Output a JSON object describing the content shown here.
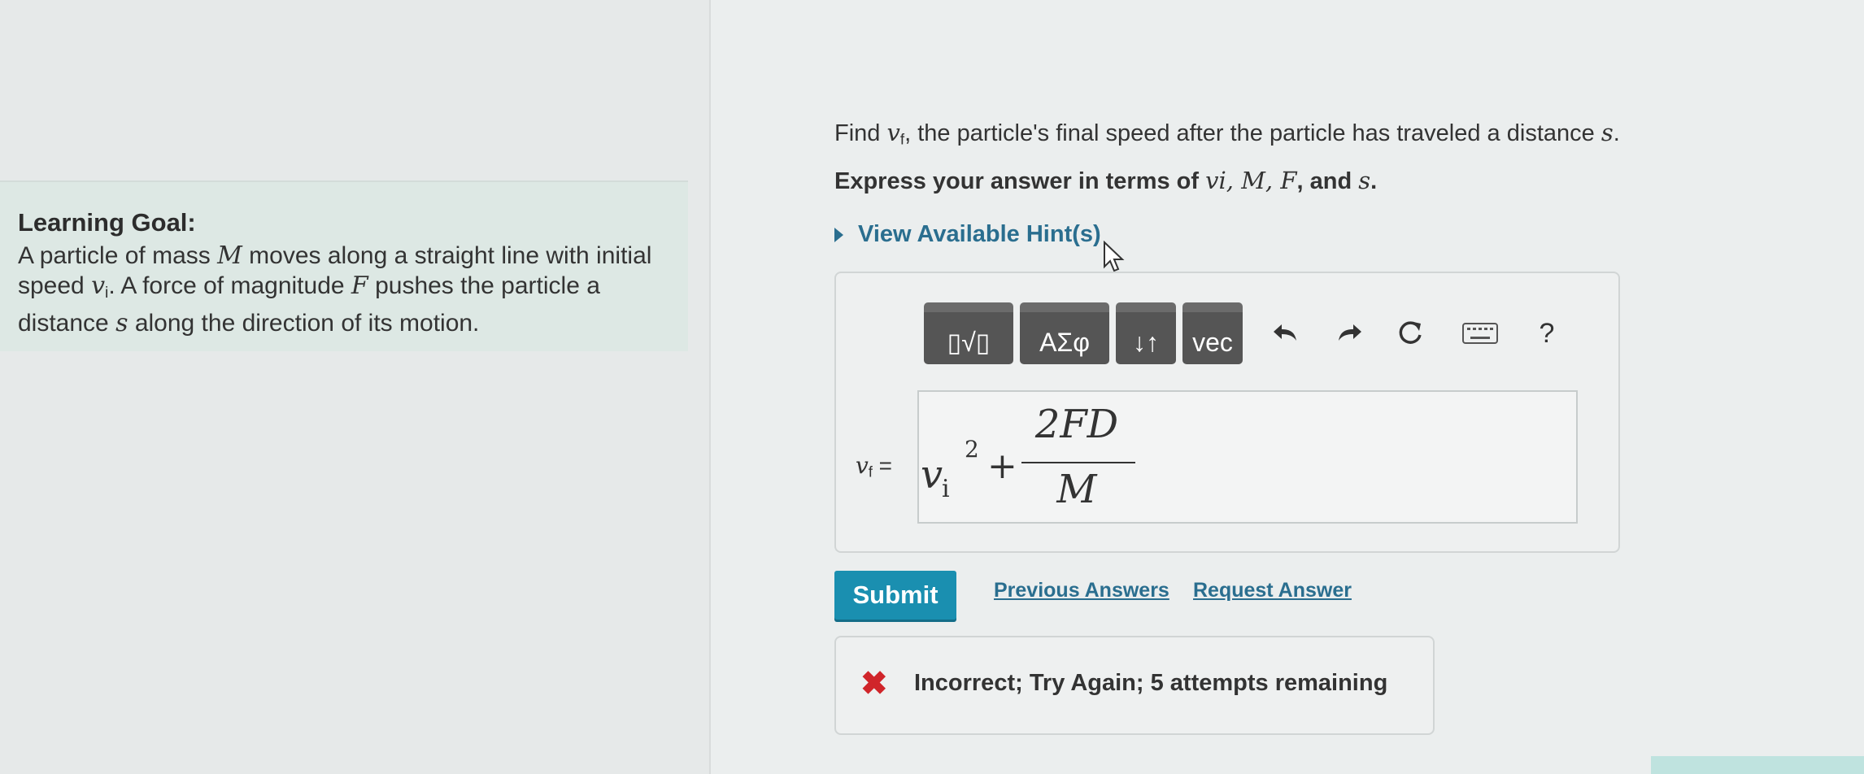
{
  "learning_goal": {
    "heading": "Learning Goal:",
    "text_1": "A particle of mass ",
    "var_M": "M",
    "text_2": " moves along a straight line with initial speed ",
    "var_v": "v",
    "var_v_sub": "i",
    "text_3": ". A force of magnitude ",
    "var_F": "F",
    "text_4": " pushes the particle a distance ",
    "var_s": "s",
    "text_5": " along the direction of its motion."
  },
  "question": {
    "find_prefix": "Find ",
    "var_v": "v",
    "var_v_sub": "f",
    "find_suffix": ", the particle's final speed after the particle has traveled a distance ",
    "var_s": "s",
    "find_end": ".",
    "express_prefix": "Express your answer in terms of ",
    "express_vars": "vi, M, F",
    "express_and": ", and ",
    "express_s": "s",
    "express_end": "."
  },
  "hint": {
    "label": "View Available Hint(s)"
  },
  "toolbar": {
    "templates_label": "▯√▯",
    "greek_label": "ΑΣφ",
    "arrows_label": "↓↑",
    "vec_label": "vec",
    "undo_icon": "undo-icon",
    "redo_icon": "redo-icon",
    "reset_icon": "reset-icon",
    "keyboard_icon": "keyboard-icon",
    "help_label": "?"
  },
  "answer": {
    "label_var": "v",
    "label_sub": "f",
    "label_eq": " =",
    "expr_v": "v",
    "expr_sub": "i",
    "expr_sup": "2",
    "expr_plus": "+",
    "numerator": "2FD",
    "denominator": "M"
  },
  "actions": {
    "submit": "Submit",
    "previous_answers": "Previous Answers",
    "request_answer": "Request Answer"
  },
  "feedback": {
    "icon": "✖",
    "message": "Incorrect; Try Again; 5 attempts remaining"
  }
}
